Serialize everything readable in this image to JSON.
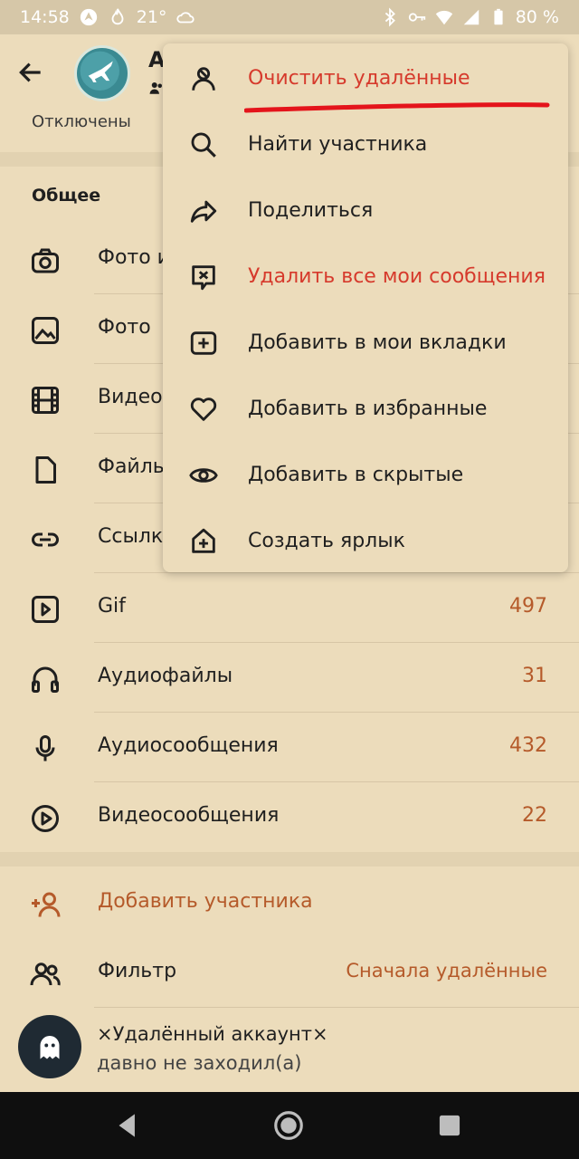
{
  "status_bar": {
    "time": "14:58",
    "temperature": "21°",
    "battery": "80 %"
  },
  "header": {
    "title": "А"
  },
  "notifications_value": "Отключены",
  "section_title": "Общее",
  "media_items": [
    {
      "label": "Фото и",
      "count": "",
      "icon": "camera-icon"
    },
    {
      "label": "Фото",
      "count": "",
      "icon": "image-icon"
    },
    {
      "label": "Видео",
      "count": "",
      "icon": "film-icon"
    },
    {
      "label": "Файль",
      "count": "",
      "icon": "file-icon"
    },
    {
      "label": "Ссылк",
      "count": "",
      "icon": "link-icon"
    },
    {
      "label": "Gif",
      "count": "497",
      "icon": "gif-icon"
    },
    {
      "label": "Аудиофайлы",
      "count": "31",
      "icon": "headphones-icon"
    },
    {
      "label": "Аудиосообщения",
      "count": "432",
      "icon": "mic-icon"
    },
    {
      "label": "Видеосообщения",
      "count": "22",
      "icon": "play-circle-icon"
    }
  ],
  "members": {
    "add_label": "Добавить участника",
    "filter_label": "Фильтр",
    "filter_value": "Сначала удалённые"
  },
  "user": {
    "name": "×Удалённый аккаунт×",
    "status": "давно не заходил(а)"
  },
  "menu": {
    "items": [
      {
        "label": "Очистить удалённые",
        "icon": "user-off-icon",
        "danger": true
      },
      {
        "label": "Найти участника",
        "icon": "search-icon",
        "danger": false
      },
      {
        "label": "Поделиться",
        "icon": "share-icon",
        "danger": false
      },
      {
        "label": "Удалить все мои сообщения",
        "icon": "delete-message-icon",
        "danger": true
      },
      {
        "label": "Добавить в мои вкладки",
        "icon": "add-tab-icon",
        "danger": false
      },
      {
        "label": "Добавить в избранные",
        "icon": "heart-icon",
        "danger": false
      },
      {
        "label": "Добавить в скрытые",
        "icon": "eye-icon",
        "danger": false
      },
      {
        "label": "Создать ярлык",
        "icon": "add-shortcut-icon",
        "danger": false
      }
    ]
  },
  "colors": {
    "background": "#ecdcbb",
    "accent": "#b55a2a",
    "danger": "#d63a2c"
  }
}
